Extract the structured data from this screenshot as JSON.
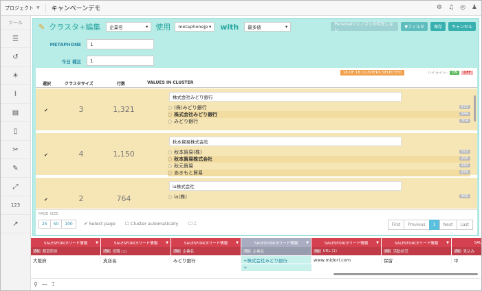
{
  "topbar": {
    "project_label": "プロジェクト",
    "project_name": "キャンペーンデモ"
  },
  "sidebar": {
    "tools_label": "ツール",
    "items": [
      {
        "icon": "list-icon",
        "glyph": "☰"
      },
      {
        "icon": "history-icon",
        "glyph": "↺"
      },
      {
        "icon": "sun-icon",
        "glyph": "☀"
      },
      {
        "icon": "paperclip-icon",
        "glyph": "⌇"
      },
      {
        "icon": "table-icon",
        "glyph": "▤"
      },
      {
        "icon": "document-icon",
        "glyph": "▯"
      },
      {
        "icon": "scissors-icon",
        "glyph": "✂"
      },
      {
        "icon": "pen-icon",
        "glyph": "✎"
      },
      {
        "icon": "expand-icon",
        "glyph": "⤢"
      },
      {
        "icon": "number-icon",
        "glyph": "123"
      },
      {
        "icon": "external-icon",
        "glyph": "↗"
      }
    ]
  },
  "dialog": {
    "title": "クラスタ+編集",
    "column_select": "企業名",
    "use_label": "使用",
    "method_select": "metaphonejp",
    "with_label": "with",
    "strategy_select": "最多値",
    "buttons": {
      "personal": "Personalジェノスシの存在しない",
      "filter": "▼フィルタ",
      "save": "保存",
      "cancel": "キャンセル"
    },
    "params": [
      {
        "label": "METAPHONE",
        "value": "1"
      },
      {
        "label": "今日 補正",
        "value": "1"
      }
    ],
    "clusters_selected": "18 OF 18 CLUSTERS SELECTED",
    "highlight_label": "ハイライト:",
    "highlight_on": "ON",
    "highlight_off": "OFF",
    "columns": {
      "select": "選択",
      "cluster_size": "クラスタサイズ",
      "row_count": "行数",
      "values": "VALUES IN CLUSTER"
    },
    "clusters": [
      {
        "checked": "✔",
        "size": "3",
        "rows": "1,321",
        "new_value": "株式会社みどり銀行",
        "values": [
          {
            "text": "(株)みどり銀行",
            "count": "673"
          },
          {
            "text": "株式会社みどり銀行",
            "count": "344"
          },
          {
            "text": "みどり銀行",
            "count": "304"
          }
        ]
      },
      {
        "checked": "✔",
        "size": "4",
        "rows": "1,150",
        "new_value": "秋本貿易株式会社",
        "values": [
          {
            "text": "秋本貿易(株)",
            "count": "322"
          },
          {
            "text": "秋本貿易株式会社",
            "count": "295"
          },
          {
            "text": "秋元貿易",
            "count": "283"
          },
          {
            "text": "あきもと貿易",
            "count": "250"
          }
        ]
      },
      {
        "checked": "✔",
        "size": "2",
        "rows": "764",
        "new_value": "ia株式会社",
        "values": [
          {
            "text": "ia(株)",
            "count": "400"
          }
        ]
      }
    ],
    "footer": {
      "page_size_label": "PAGE SIZE",
      "page_sizes": [
        "25",
        "50",
        "100"
      ],
      "select_page": "Select page",
      "cluster_auto": "Cluster automatically",
      "pager": [
        "First",
        "Previous",
        "1",
        "Next",
        "Last"
      ]
    }
  },
  "grid": {
    "columns": [
      {
        "source": "SALESFORCEリード情報",
        "name": "都道府県",
        "color": "#d64150",
        "r1": "大阪府",
        "r2": ""
      },
      {
        "source": "SALESFORCEリード情報",
        "name": "役職 (1)",
        "color": "#d64150",
        "r1": "支店長",
        "r2": ""
      },
      {
        "source": "SALESFORCEリード情報",
        "name": "企業名",
        "color": "#d64150",
        "r1": "みどり銀行",
        "r2": ""
      },
      {
        "source": "SALESFORCEリード情報",
        "name": "企業名",
        "color": "#a9adc2",
        "r1": "+株式会社みどり銀行",
        "r2": "+"
      },
      {
        "source": "SALESFORCEリード情報",
        "name": "URL (1)",
        "color": "#d64150",
        "r1": "www.midori.com",
        "r2": ""
      },
      {
        "source": "SALESFORCEリード情報",
        "name": "活動状況",
        "color": "#d64150",
        "r1": "保留",
        "r2": ""
      },
      {
        "source": "SALESFORCE",
        "name": "見込み",
        "color": "#d64150",
        "r1": "中",
        "r2": ""
      }
    ]
  },
  "bottom_icons": [
    "search-icon",
    "minus-icon",
    "text-icon"
  ]
}
